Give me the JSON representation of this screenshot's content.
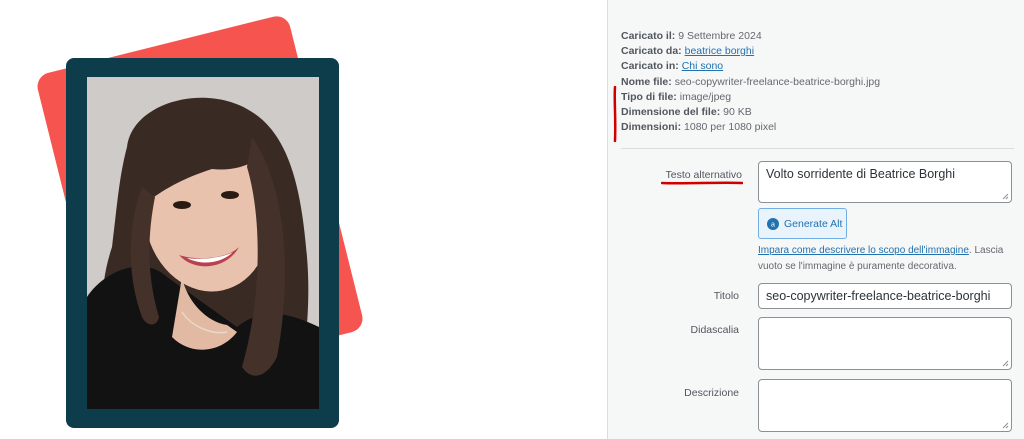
{
  "meta": {
    "uploaded_on_label": "Caricato il:",
    "uploaded_on_value": "9 Settembre 2024",
    "uploaded_by_label": "Caricato da:",
    "uploaded_by_value": "beatrice borghi",
    "uploaded_to_label": "Caricato in:",
    "uploaded_to_value": "Chi sono",
    "file_name_label": "Nome file:",
    "file_name_value": "seo-copywriter-freelance-beatrice-borghi.jpg",
    "file_type_label": "Tipo di file:",
    "file_type_value": "image/jpeg",
    "file_size_label": "Dimensione del file:",
    "file_size_value": "90 KB",
    "dimensions_label": "Dimensioni:",
    "dimensions_value": "1080 per 1080 pixel"
  },
  "fields": {
    "alt_label": "Testo alternativo",
    "alt_value": "Volto sorridente di Beatrice Borghi",
    "generate_alt_label": "Generate Alt",
    "help_link": "Impara come descrivere lo scopo dell'immagine",
    "help_text": ". Lascia vuoto se l'immagine è puramente decorativa.",
    "title_label": "Titolo",
    "title_value": "seo-copywriter-freelance-beatrice-borghi",
    "caption_label": "Didascalia",
    "caption_value": "",
    "description_label": "Descrizione",
    "description_value": ""
  },
  "colors": {
    "accent_red": "#f6554f",
    "frame_dark": "#0d3d4a",
    "link_blue": "#2271b1",
    "annotation_red": "#d10000"
  },
  "icons": {
    "generate_alt_icon": "ai-badge-icon"
  }
}
